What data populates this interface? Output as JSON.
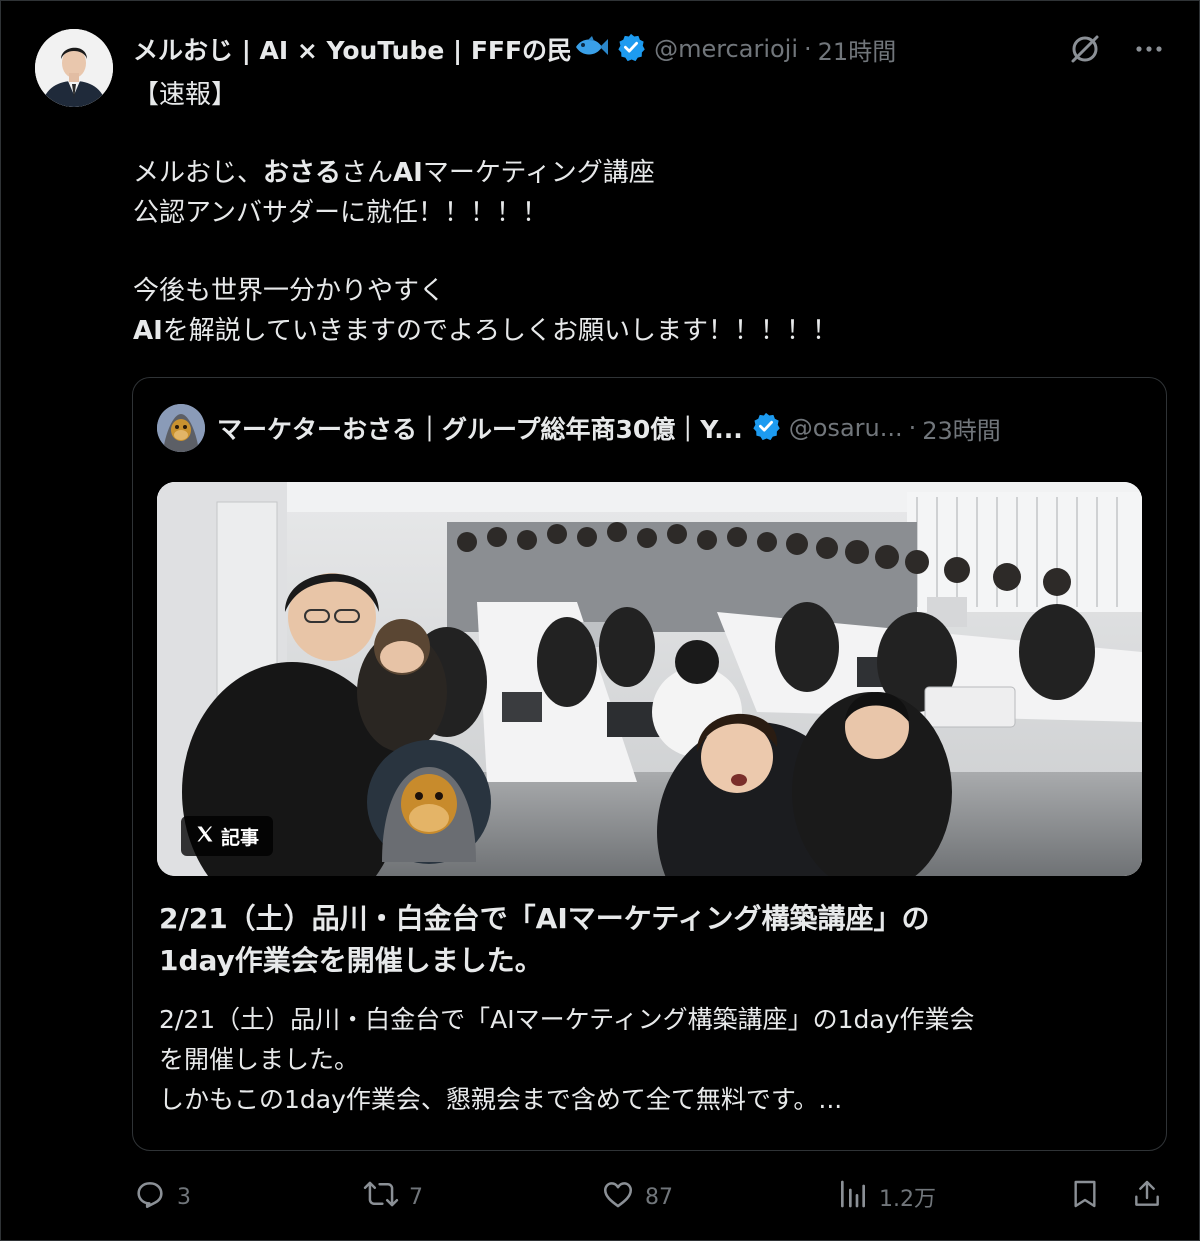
{
  "author": {
    "display_name": "メルおじ | AI × YouTube | FFFの民",
    "handle": "@mercarioji",
    "time": "21時間",
    "verified": true
  },
  "tweet": {
    "tag": "【速報】",
    "p1_a": "メルおじ、",
    "p1_b": "おさる",
    "p1_c": "さん",
    "p1_d": "AI",
    "p1_e": "マーケティング講座",
    "p1_line2": "公認アンバサダーに就任！！！！！",
    "p2_line1": "今後も世界一分かりやすく",
    "p2_ai": "AI",
    "p2_rest": "を解説していきますのでよろしくお願いします！！！！！"
  },
  "quote": {
    "display_name": "マーケターおさる｜グループ総年商30億｜Y...",
    "handle": "@osaru...",
    "time": "23時間",
    "badge": "記事",
    "article_title_line1": "2/21（土）品川・白金台で「AIマーケティング構築講座」の",
    "article_title_line2": "1day作業会を開催しました。",
    "article_body_line1": "2/21（土）品川・白金台で「AIマーケティング構築講座」の1day作業会",
    "article_body_line2": "を開催しました。",
    "article_body_line3": "しかもこの1day作業会、懇親会まで含めて全て無料です。..."
  },
  "actions": {
    "replies": "3",
    "reposts": "7",
    "likes": "87",
    "views": "1.2万"
  },
  "colors": {
    "background": "#000000",
    "text": "#e7e9ea",
    "muted": "#71767b",
    "border": "#2f3336",
    "verified": "#1d9bf0"
  },
  "icons": [
    "verified-badge-icon",
    "fish-emoji-icon",
    "grok-icon",
    "more-icon",
    "x-logo-icon",
    "reply-icon",
    "repost-icon",
    "like-icon",
    "views-icon",
    "bookmark-icon",
    "share-icon"
  ]
}
